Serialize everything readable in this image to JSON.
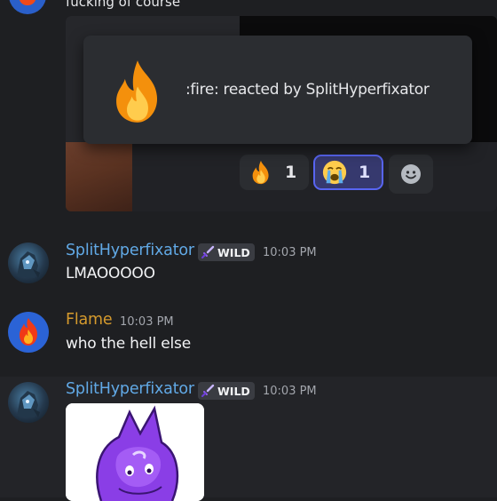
{
  "top_message": {
    "text": "fucking of course"
  },
  "tooltip": {
    "emoji_icon": "fire-emoji",
    "text": ":fire: reacted by SplitHyperfixator"
  },
  "reactions": [
    {
      "emoji": "fire-emoji",
      "count": "1",
      "active": false
    },
    {
      "emoji": "loudly-crying-emoji",
      "count": "1",
      "active": true
    }
  ],
  "add_reaction_icon": "smiley-face-icon",
  "messages": [
    {
      "author": "SplitHyperfixator",
      "tag": "WILD",
      "time": "10:03 PM",
      "text": "LMAOOOOO"
    },
    {
      "author": "Flame",
      "time": "10:03 PM",
      "text": "who the hell else"
    },
    {
      "author": "SplitHyperfixator",
      "tag": "WILD",
      "time": "10:03 PM",
      "text": ""
    }
  ],
  "colors": {
    "background": "#1e1f22",
    "split_name": "#61a9e6",
    "flame_name": "#d59a2d",
    "active_reaction_border": "#5865f2"
  }
}
